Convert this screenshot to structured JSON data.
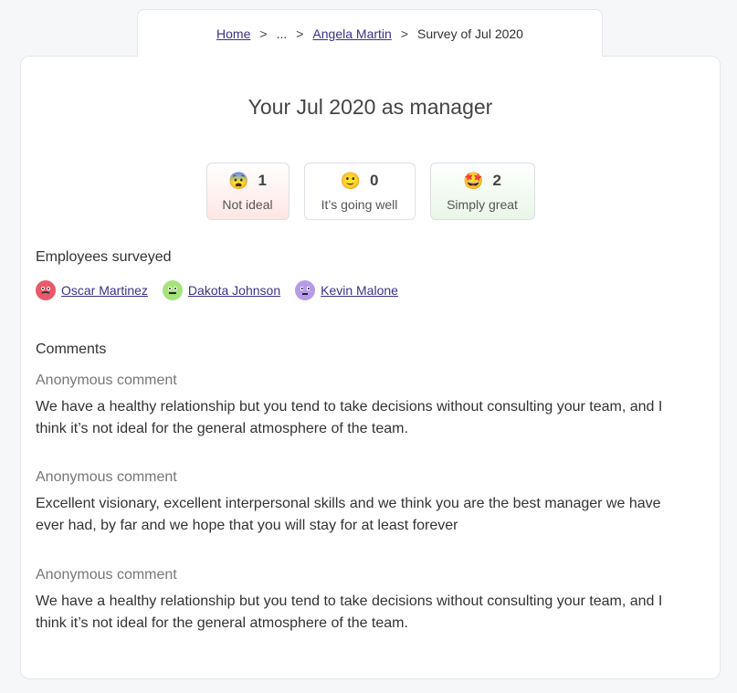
{
  "breadcrumb": {
    "home": "Home",
    "separator": ">",
    "ellipsis": "...",
    "person": "Angela Martin",
    "current": "Survey of Jul 2020"
  },
  "title": "Your Jul 2020 as manager",
  "scores": [
    {
      "emoji": "😨",
      "count": "1",
      "label": "Not ideal"
    },
    {
      "emoji": "🙂",
      "count": "0",
      "label": "It’s going well"
    },
    {
      "emoji": "🤩",
      "count": "2",
      "label": "Simply great"
    }
  ],
  "employees_title": "Employees surveyed",
  "employees": [
    {
      "name": "Oscar Martinez",
      "avatar_color": "#e85a6a"
    },
    {
      "name": "Dakota Johnson",
      "avatar_color": "#a6e37a"
    },
    {
      "name": "Kevin Malone",
      "avatar_color": "#b79be8"
    }
  ],
  "comments_title": "Comments",
  "comments": [
    {
      "author": "Anonymous comment",
      "text": "We have a healthy relationship but you tend to take decisions without consulting your team, and I think it’s not ideal for the general atmosphere of the team."
    },
    {
      "author": "Anonymous comment",
      "text": "Excellent visionary, excellent interpersonal skills and we think you are the best manager we have ever had, by far and we hope that you will stay for at least forever"
    },
    {
      "author": "Anonymous comment",
      "text": "We have a healthy relationship but you tend to take decisions without consulting your team, and I think it’s not ideal for the general atmosphere of the team."
    }
  ]
}
